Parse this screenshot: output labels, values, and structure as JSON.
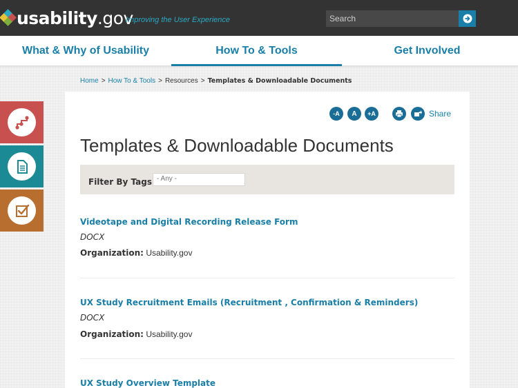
{
  "header": {
    "logo_text": "usability",
    "logo_suffix": ".gov",
    "tagline": "Improving the User Experience",
    "search": {
      "placeholder": "Search"
    }
  },
  "nav": {
    "items": [
      {
        "label": "What & Why of Usability"
      },
      {
        "label": "How To & Tools",
        "active": true
      },
      {
        "label": "Get Involved"
      }
    ]
  },
  "breadcrumb": {
    "home": "Home",
    "how_to": "How To & Tools",
    "resources": "Resources",
    "current": "Templates & Downloadable Documents",
    "separator": ">"
  },
  "side_tabs": [
    {
      "icon": "methods-icon",
      "color": "#c8504e"
    },
    {
      "icon": "document-icon",
      "color": "#1b8a94"
    },
    {
      "icon": "checklist-icon",
      "color": "#b86e2e"
    }
  ],
  "toolbar": {
    "decrease_font": "-A",
    "reset_font": "A",
    "increase_font": "+A",
    "share_label": "Share"
  },
  "page": {
    "title": "Templates & Downloadable Documents",
    "filter_label": "Filter By Tags:",
    "filter_value": "- Any -"
  },
  "documents": [
    {
      "title": "Videotape and Digital Recording Release Form",
      "type": "DOCX",
      "org_label": "Organization:",
      "org": "Usability.gov"
    },
    {
      "title": "UX Study Recruitment Emails (Recruitment , Confirmation & Reminders)",
      "type": "DOCX",
      "org_label": "Organization:",
      "org": "Usability.gov"
    },
    {
      "title": "UX Study Overview Template"
    }
  ],
  "colors": {
    "header_bg": "#333333",
    "accent": "#1a7fa8",
    "filter_bg": "#e8e4df"
  }
}
